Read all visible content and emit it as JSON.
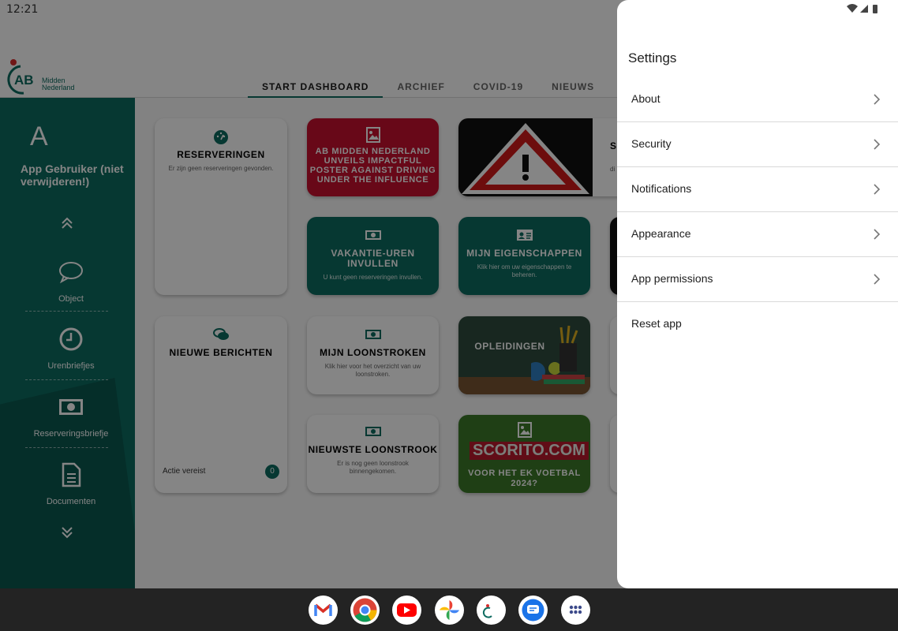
{
  "status_bar": {
    "time": "12:21"
  },
  "app": {
    "logo": {
      "mark": "AB",
      "subtitle": "Midden Nederland"
    },
    "tabs": [
      {
        "label": "START DASHBOARD",
        "active": true
      },
      {
        "label": "ARCHIEF"
      },
      {
        "label": "COVID-19"
      },
      {
        "label": "NIEUWS"
      }
    ],
    "sidebar": {
      "avatar_letter": "A",
      "user_name": "App Gebruiker (niet verwijderen!)",
      "items": [
        {
          "label": "Object",
          "icon": "chat-bubble-icon"
        },
        {
          "label": "Urenbriefjes",
          "icon": "clock-icon"
        },
        {
          "label": "Reserveringsbriefje",
          "icon": "money-icon"
        },
        {
          "label": "Documenten",
          "icon": "document-icon"
        }
      ]
    },
    "cards": {
      "reserveringen": {
        "title": "RESERVERINGEN",
        "subtitle": "Er zijn geen reserveringen gevonden."
      },
      "poster": {
        "title": "AB MIDDEN NEDERLAND UNVEILS IMPACTFUL POSTER AGAINST DRIVING UNDER THE INFLUENCE"
      },
      "warning_partial": {
        "title": "S",
        "subtitle": "di"
      },
      "vakantie": {
        "title": "VAKANTIE-UREN INVULLEN",
        "subtitle": "U kunt geen reserveringen invullen."
      },
      "eigenschappen": {
        "title": "MIJN EIGENSCHAPPEN",
        "subtitle": "Klik hier om uw eigenschappen te beheren."
      },
      "berichten": {
        "title": "NIEUWE BERICHTEN",
        "footer": "Actie vereist",
        "count": "0"
      },
      "loonstroken": {
        "title": "MIJN LOONSTROKEN",
        "subtitle": "Klik hier voor het overzicht van uw loonstroken."
      },
      "opleidingen": {
        "title": "OPLEIDINGEN"
      },
      "nieuwste": {
        "title": "NIEUWSTE LOONSTROOK",
        "subtitle": "Er is nog geen loonstrook binnengekomen."
      },
      "voetbal": {
        "title": "VOOR HET EK VOETBAL 2024?",
        "overlay": "SCORITO.COM"
      }
    }
  },
  "settings": {
    "title": "Settings",
    "items": [
      {
        "label": "About",
        "has_arrow": true
      },
      {
        "label": "Security",
        "has_arrow": true
      },
      {
        "label": "Notifications",
        "has_arrow": true
      },
      {
        "label": "Appearance",
        "has_arrow": true
      },
      {
        "label": "App permissions",
        "has_arrow": true
      },
      {
        "label": "Reset app",
        "has_arrow": false
      }
    ]
  },
  "taskbar": {
    "apps": [
      "gmail-icon",
      "chrome-icon",
      "youtube-icon",
      "photos-icon",
      "ab-app-icon",
      "messages-icon",
      "app-drawer-icon"
    ]
  },
  "colors": {
    "brand_green": "#0d6b60",
    "poster_red": "#c8102e"
  }
}
